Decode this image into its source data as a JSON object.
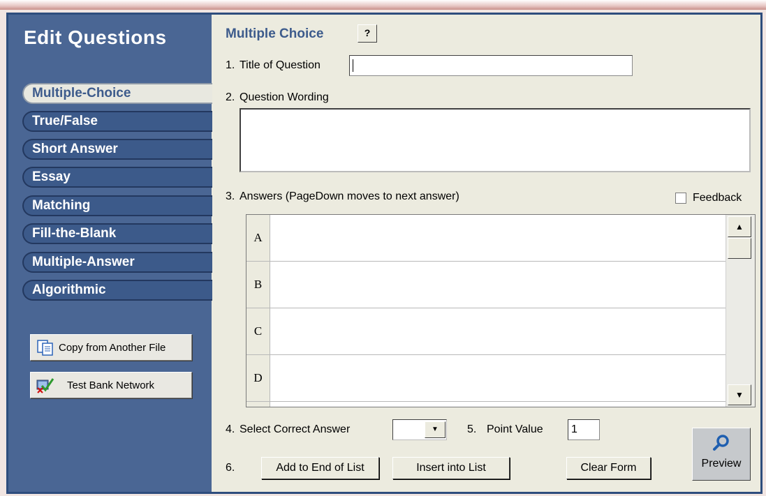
{
  "sidebar": {
    "title": "Edit Questions",
    "tabs": [
      {
        "label": "Multiple-Choice",
        "active": true
      },
      {
        "label": "True/False"
      },
      {
        "label": "Short Answer"
      },
      {
        "label": "Essay"
      },
      {
        "label": "Matching"
      },
      {
        "label": "Fill-the-Blank"
      },
      {
        "label": "Multiple-Answer"
      },
      {
        "label": "Algorithmic"
      }
    ],
    "copy_button": "Copy from Another File",
    "network_button": "Test Bank Network"
  },
  "main": {
    "title": "Multiple Choice",
    "help_label": "?",
    "step1": {
      "num": "1.",
      "label": "Title of Question",
      "value": ""
    },
    "step2": {
      "num": "2.",
      "label": "Question Wording",
      "value": ""
    },
    "step3": {
      "num": "3.",
      "label": "Answers  (PageDown moves to next answer)",
      "feedback_label": "Feedback",
      "feedback_checked": false
    },
    "answers": [
      {
        "letter": "A",
        "value": ""
      },
      {
        "letter": "B",
        "value": ""
      },
      {
        "letter": "C",
        "value": ""
      },
      {
        "letter": "D",
        "value": ""
      }
    ],
    "step4": {
      "num": "4.",
      "label": "Select Correct Answer",
      "value": ""
    },
    "step5": {
      "num": "5.",
      "label": "Point Value",
      "value": "1"
    },
    "step6": {
      "num": "6.",
      "add_label": "Add to End of List",
      "insert_label": "Insert into List"
    },
    "clear_label": "Clear Form",
    "preview_label": "Preview"
  }
}
